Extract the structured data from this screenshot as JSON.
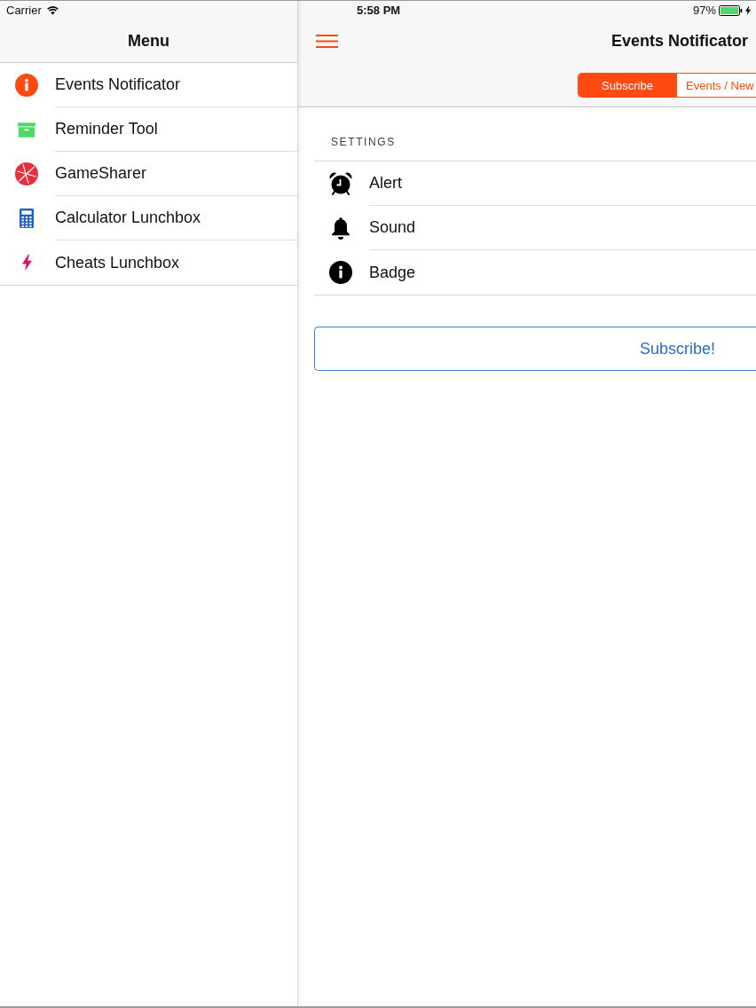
{
  "status_bar": {
    "carrier": "Carrier",
    "time": "5:58 PM",
    "battery": "97%"
  },
  "menu": {
    "title": "Menu",
    "items": [
      {
        "label": "Events Notificator",
        "color": "#ff4a12"
      },
      {
        "label": "Reminder Tool",
        "color": "#4cd964"
      },
      {
        "label": "GameSharer",
        "color": "#e8303a"
      },
      {
        "label": "Calculator Lunchbox",
        "color": "#1e63c4"
      },
      {
        "label": "Cheats Lunchbox",
        "color": "#d8146f"
      }
    ]
  },
  "nav_bar": {
    "title": "Events Notificator",
    "segments": [
      {
        "label": "Subscribe",
        "selected": true
      },
      {
        "label": "Events / New",
        "selected": false
      }
    ]
  },
  "settings": {
    "header": "SETTINGS",
    "rows": [
      {
        "label": "Alert"
      },
      {
        "label": "Sound"
      },
      {
        "label": "Badge"
      }
    ]
  },
  "subscribe_button": {
    "label": "Subscribe!"
  }
}
